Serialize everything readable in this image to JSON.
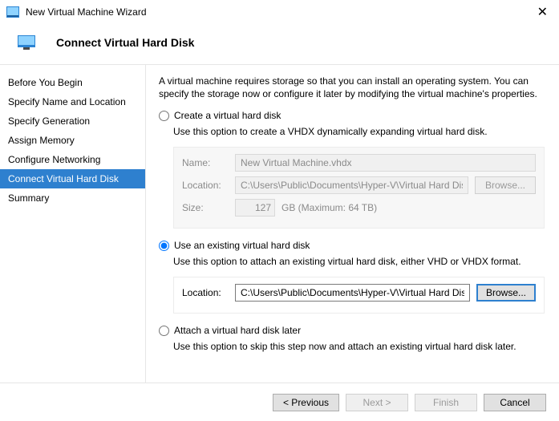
{
  "window": {
    "title": "New Virtual Machine Wizard"
  },
  "header": {
    "title": "Connect Virtual Hard Disk"
  },
  "sidebar": {
    "items": [
      {
        "label": "Before You Begin"
      },
      {
        "label": "Specify Name and Location"
      },
      {
        "label": "Specify Generation"
      },
      {
        "label": "Assign Memory"
      },
      {
        "label": "Configure Networking"
      },
      {
        "label": "Connect Virtual Hard Disk"
      },
      {
        "label": "Summary"
      }
    ],
    "selected_index": 5
  },
  "main": {
    "intro": "A virtual machine requires storage so that you can install an operating system. You can specify the storage now or configure it later by modifying the virtual machine's properties.",
    "option_create": {
      "label": "Create a virtual hard disk",
      "desc": "Use this option to create a VHDX dynamically expanding virtual hard disk.",
      "name_label": "Name:",
      "name_value": "New Virtual Machine.vhdx",
      "location_label": "Location:",
      "location_value": "C:\\Users\\Public\\Documents\\Hyper-V\\Virtual Hard Disks\\",
      "browse_label": "Browse...",
      "size_label": "Size:",
      "size_value": "127",
      "size_suffix": "GB (Maximum: 64 TB)"
    },
    "option_existing": {
      "label": "Use an existing virtual hard disk",
      "desc": "Use this option to attach an existing virtual hard disk, either VHD or VHDX format.",
      "location_label": "Location:",
      "location_value": "C:\\Users\\Public\\Documents\\Hyper-V\\Virtual Hard Disks\\",
      "browse_label": "Browse..."
    },
    "option_later": {
      "label": "Attach a virtual hard disk later",
      "desc": "Use this option to skip this step now and attach an existing virtual hard disk later."
    },
    "selected_option": "existing"
  },
  "footer": {
    "previous": "< Previous",
    "next": "Next >",
    "finish": "Finish",
    "cancel": "Cancel"
  }
}
